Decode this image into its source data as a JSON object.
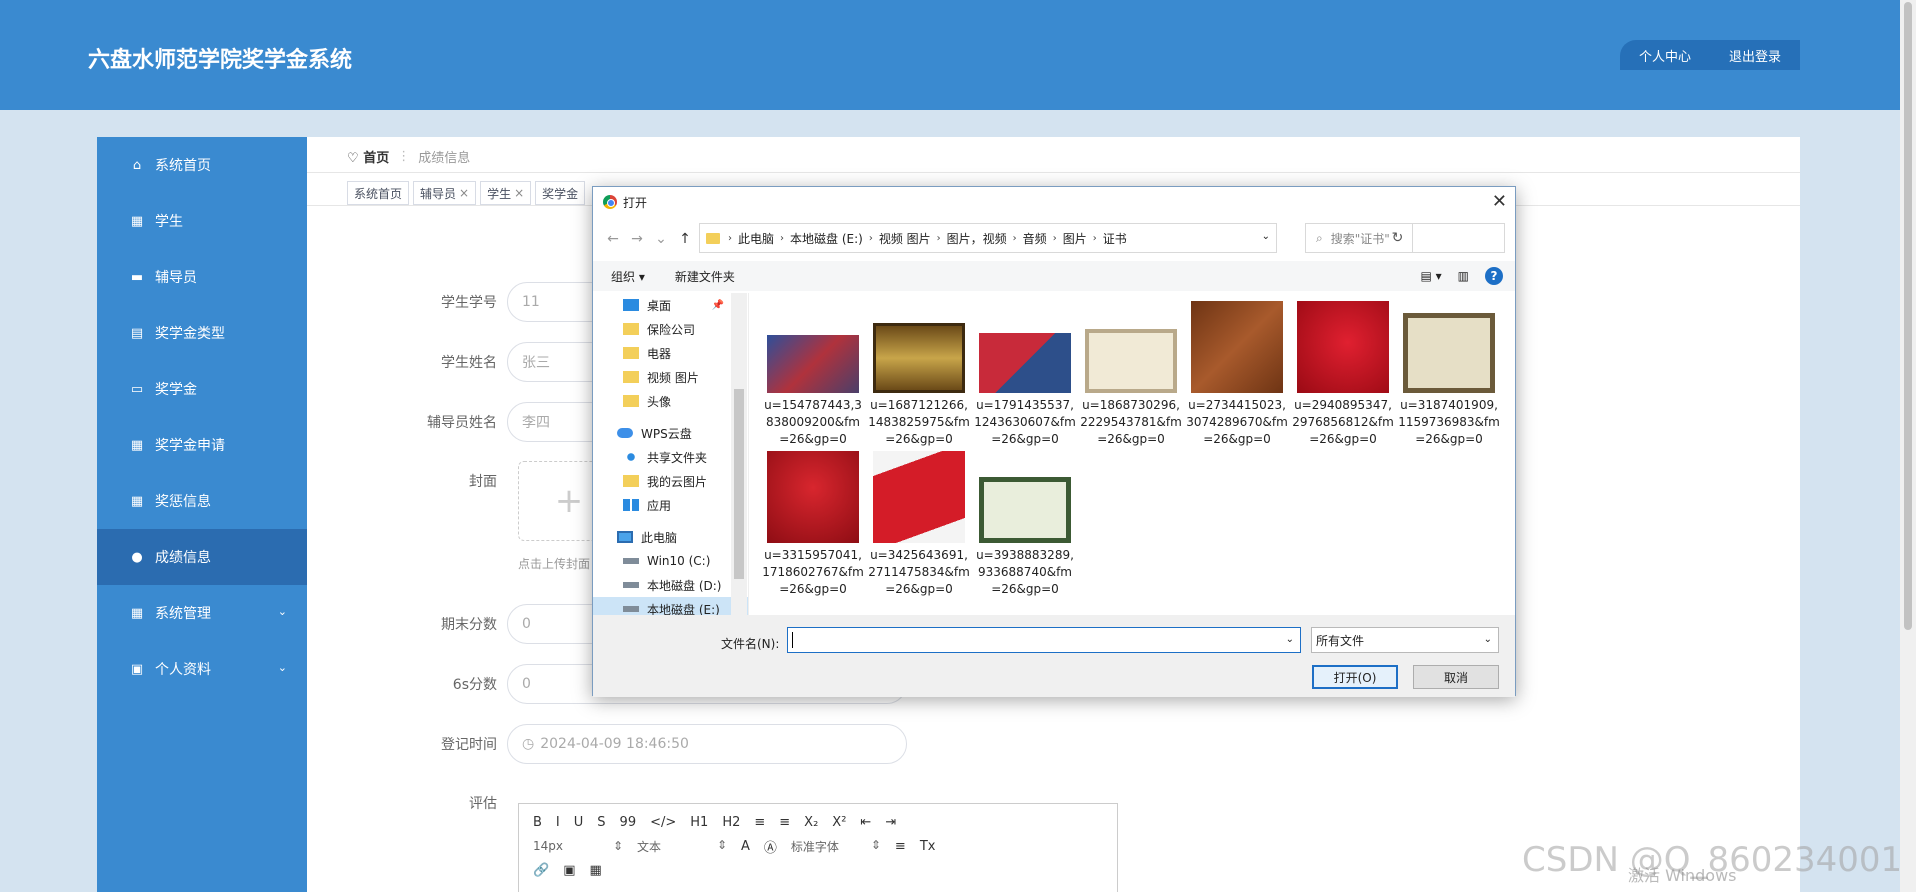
{
  "header": {
    "title": "六盘水师范学院奖学金系统",
    "user_center": "个人中心",
    "logout": "退出登录"
  },
  "sidebar": {
    "items": [
      {
        "label": "系统首页",
        "icon": "home-icon"
      },
      {
        "label": "学生",
        "icon": "grid-icon"
      },
      {
        "label": "辅导员",
        "icon": "monitor-icon"
      },
      {
        "label": "奖学金类型",
        "icon": "clipboard-icon"
      },
      {
        "label": "奖学金",
        "icon": "id-card-icon"
      },
      {
        "label": "奖学金申请",
        "icon": "grid-icon"
      },
      {
        "label": "奖惩信息",
        "icon": "table-icon"
      },
      {
        "label": "成绩信息",
        "icon": "bulb-icon"
      },
      {
        "label": "系统管理",
        "icon": "grid-icon"
      },
      {
        "label": "个人资料",
        "icon": "calendar-icon"
      }
    ],
    "active": "成绩信息"
  },
  "breadcrumb": {
    "home": "首页",
    "current": "成绩信息"
  },
  "tabs": [
    {
      "label": "系统首页",
      "closable": false
    },
    {
      "label": "辅导员",
      "closable": true
    },
    {
      "label": "学生",
      "closable": true
    },
    {
      "label": "奖学金",
      "closable": false
    }
  ],
  "form": {
    "student_no": {
      "label": "学生学号",
      "value": "11"
    },
    "student_name": {
      "label": "学生姓名",
      "value": "张三"
    },
    "counselor_name": {
      "label": "辅导员姓名",
      "value": "李四"
    },
    "cover": {
      "label": "封面",
      "tip": "点击上传封面"
    },
    "final_score": {
      "label": "期末分数",
      "value": "0"
    },
    "six_s_score": {
      "label": "6s分数",
      "value": "0"
    },
    "reg_time": {
      "label": "登记时间",
      "value": "2024-04-09 18:46:50"
    },
    "evaluation": {
      "label": "评估"
    }
  },
  "editor": {
    "row1": [
      "B",
      "I",
      "U",
      "S",
      "99",
      "</>",
      "H1",
      "H2",
      "≡",
      "≡",
      "X₂",
      "X²",
      "⇤",
      "⇥"
    ],
    "font_size": "14px",
    "text_type": "文本",
    "font_family": "标准字体"
  },
  "watermark": {
    "csdn": "CSDN @Q_860234001",
    "windows": "激活 Windows"
  },
  "dialog": {
    "title": "打开",
    "path": [
      "此电脑",
      "本地磁盘 (E:)",
      "视频 图片",
      "图片，视频",
      "音频",
      "图片",
      "证书"
    ],
    "search_placeholder": "搜索\"证书\"",
    "organize": "组织 ▾",
    "new_folder": "新建文件夹",
    "tree": [
      {
        "label": "桌面",
        "icon": "desktop",
        "pinned": true
      },
      {
        "label": "保险公司",
        "icon": "folder"
      },
      {
        "label": "电器",
        "icon": "folder"
      },
      {
        "label": "视频 图片",
        "icon": "folder"
      },
      {
        "label": "头像",
        "icon": "folder"
      },
      {
        "label": "WPS云盘",
        "icon": "cloud"
      },
      {
        "label": "共享文件夹",
        "icon": "share"
      },
      {
        "label": "我的云图片",
        "icon": "folder"
      },
      {
        "label": "应用",
        "icon": "apps"
      },
      {
        "label": "此电脑",
        "icon": "pc"
      },
      {
        "label": "Win10 (C:)",
        "icon": "drive"
      },
      {
        "label": "本地磁盘 (D:)",
        "icon": "drive"
      },
      {
        "label": "本地磁盘 (E:)",
        "icon": "drive",
        "selected": true
      }
    ],
    "files": [
      {
        "name": "u=154787443,3838009200&fm=26&gp=0",
        "color": "#3a5aa8"
      },
      {
        "name": "u=1687121266,1483825975&fm=26&gp=0",
        "color": "#7a5a20"
      },
      {
        "name": "u=1791435537,1243630607&fm=26&gp=0",
        "color": "#c82a3a"
      },
      {
        "name": "u=1868730296,2229543781&fm=26&gp=0",
        "color": "#e9e0c8"
      },
      {
        "name": "u=2734415023,3074289670&fm=26&gp=0",
        "color": "#8a4a24"
      },
      {
        "name": "u=2940895347,2976856812&fm=26&gp=0",
        "color": "#c8101c"
      },
      {
        "name": "u=3187401909,1159736983&fm=26&gp=0",
        "color": "#cfc6a6"
      },
      {
        "name": "u=3315957041,1718602767&fm=26&gp=0",
        "color": "#c31a22"
      },
      {
        "name": "u=3425643691,2711475834&fm=26&gp=0",
        "color": "#d41c28"
      },
      {
        "name": "u=3938883289,933688740&fm=26&gp=0",
        "color": "#5a7a4a"
      }
    ],
    "filename_label": "文件名(N):",
    "filename_value": "",
    "filetype": "所有文件",
    "open_btn": "打开(O)",
    "cancel_btn": "取消"
  }
}
